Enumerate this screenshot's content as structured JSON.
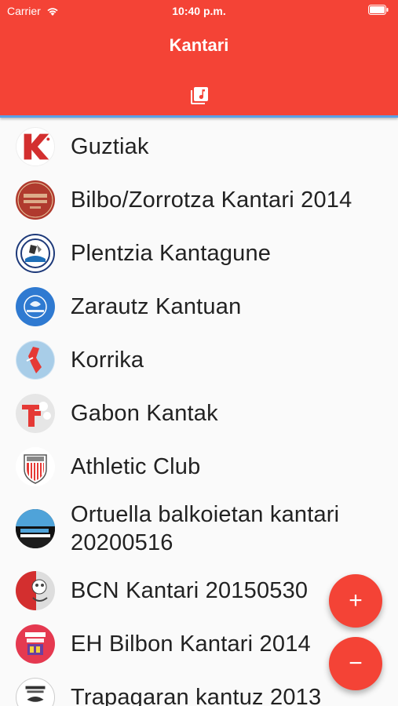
{
  "status_bar": {
    "carrier": "Carrier",
    "time": "10:40 p.m."
  },
  "app_bar": {
    "title": "Kantari",
    "tab_icon": "library-music-icon"
  },
  "colors": {
    "primary": "#f44336",
    "tab_indicator": "#5aa0e6"
  },
  "list": {
    "items": [
      {
        "label": "Guztiak",
        "icon": "kantari-logo-icon"
      },
      {
        "label": "Bilbo/Zorrotza Kantari 2014",
        "icon": "bilbo-kantari-logo-icon"
      },
      {
        "label": "Plentzia Kantagune",
        "icon": "plentzia-logo-icon"
      },
      {
        "label": "Zarautz Kantuan",
        "icon": "zarautz-logo-icon"
      },
      {
        "label": "Korrika",
        "icon": "korrika-logo-icon"
      },
      {
        "label": "Gabon Kantak",
        "icon": "gabon-logo-icon"
      },
      {
        "label": "Athletic Club",
        "icon": "athletic-club-crest-icon"
      },
      {
        "label": "Ortuella balkoietan kantari 20200516",
        "icon": "kantu-kalejira-logo-icon"
      },
      {
        "label": "BCN Kantari 20150530",
        "icon": "bcn-logo-icon"
      },
      {
        "label": "EH Bilbon Kantari 2014",
        "icon": "eh-bilbon-logo-icon"
      },
      {
        "label": "Trapagaran kantuz 2013",
        "icon": "trapagaran-logo-icon"
      }
    ]
  },
  "fab": {
    "add_symbol": "+",
    "remove_symbol": "−"
  }
}
